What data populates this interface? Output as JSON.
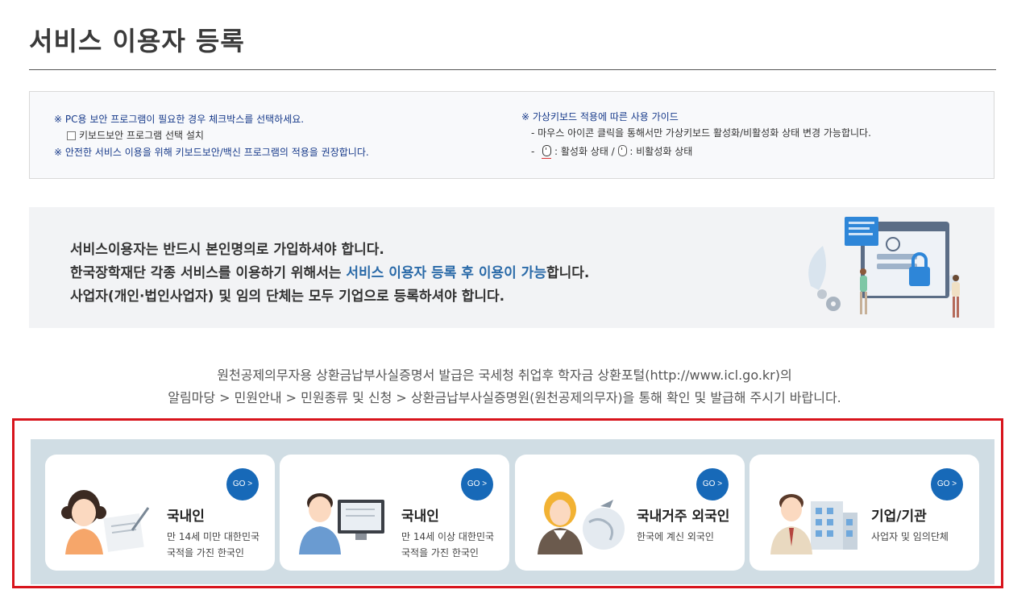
{
  "page": {
    "title": "서비스 이용자 등록"
  },
  "notice": {
    "left": {
      "line1": "※ PC용 보안 프로그램이 필요한 경우 체크박스를 선택하세요.",
      "checkbox_label": "키보드보안 프로그램 선택 설치",
      "line3": "※ 안전한 서비스 이용을 위해 키보드보안/백신 프로그램의 적용을 권장합니다."
    },
    "right": {
      "title": "※ 가상키보드 적용에 따른 사용 가이드",
      "line2": "- 마우스 아이콘 클릭을 통해서만 가상키보드 활성화/비활성화 상태 변경 가능합니다.",
      "dash": "-",
      "active_label": ": 활성화 상태 /",
      "inactive_label": ": 비활성화 상태"
    }
  },
  "intro": {
    "line1": "서비스이용자는 반드시 본인명의로 가입하셔야 합니다.",
    "line2_before": "한국장학재단 각종 서비스를 이용하기 위해서는 ",
    "line2_highlight": "서비스 이용자 등록 후 이용이 가능",
    "line2_after": "합니다.",
    "line3": "사업자(개인·법인사업자) 및 임의 단체는 모두 기업으로 등록하셔야 합니다."
  },
  "info": {
    "line1": "원천공제의무자용 상환금납부사실증명서 발급은 국세청 취업후 학자금 상환포털(http://www.icl.go.kr)의",
    "line2": "알림마당 > 민원안내 > 민원종류 및 신청 > 상환금납부사실증명원(원천공제의무자)을 통해 확인 및 발급해 주시기 바랍니다."
  },
  "cards": [
    {
      "title": "국내인",
      "desc1": "만 14세 미만 대한민국",
      "desc2": "국적을 가진 한국인",
      "go": "GO >"
    },
    {
      "title": "국내인",
      "desc1": "만 14세 이상 대한민국",
      "desc2": "국적을 가진 한국인",
      "go": "GO >"
    },
    {
      "title": "국내거주 외국인",
      "desc1": "한국에 계신 외국인",
      "desc2": "",
      "go": "GO >"
    },
    {
      "title": "기업/기관",
      "desc1": "사업자 및 임의단체",
      "desc2": "",
      "go": "GO >"
    }
  ],
  "colors": {
    "accent": "#1769b8",
    "frame": "#d8141c",
    "strip": "#d0dde4",
    "highlight_text": "#2a6aa8"
  }
}
